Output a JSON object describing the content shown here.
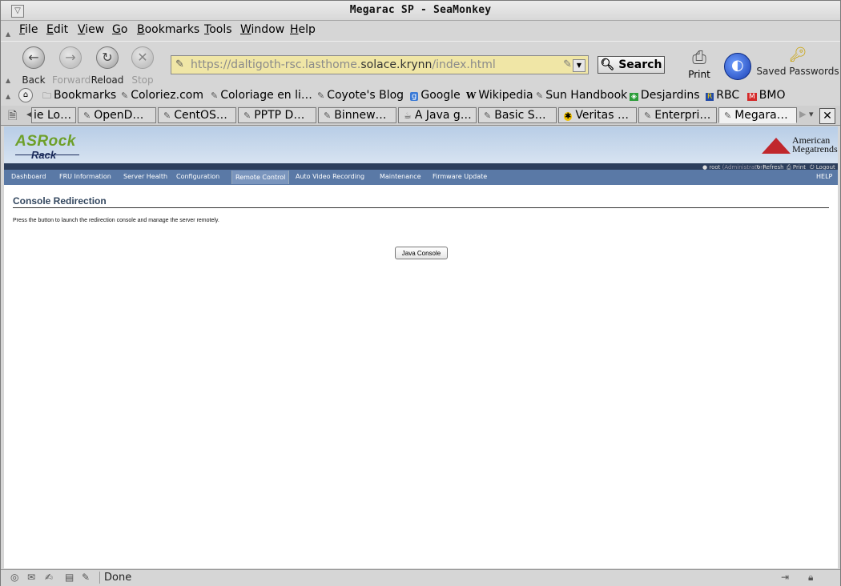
{
  "window": {
    "title": "Megarac SP - SeaMonkey",
    "wm_button": "▽"
  },
  "menubar": {
    "items": [
      {
        "label": "File",
        "underline": "F",
        "rest": "ile"
      },
      {
        "label": "Edit",
        "underline": "E",
        "rest": "dit"
      },
      {
        "label": "View",
        "underline": "V",
        "rest": "iew"
      },
      {
        "label": "Go",
        "underline": "G",
        "rest": "o"
      },
      {
        "label": "Bookmarks",
        "underline": "B",
        "rest": "ookmarks"
      },
      {
        "label": "Tools",
        "underline": "T",
        "rest": "ools"
      },
      {
        "label": "Window",
        "underline": "W",
        "rest": "indow"
      },
      {
        "label": "Help",
        "underline": "H",
        "rest": "elp"
      }
    ]
  },
  "navbar": {
    "back": "Back",
    "forward": "Forward",
    "reload": "Reload",
    "stop": "Stop",
    "url_prefix": "https://daltigoth-rsc.lasthome.",
    "url_host": "solace.krynn",
    "url_suffix": "/index.html",
    "search": "Search",
    "print": "Print",
    "saved_passwords": "Saved Passwords"
  },
  "bookmarks": [
    {
      "label": "Bookmarks",
      "icon": "folder-icon"
    },
    {
      "label": "Coloriez.com",
      "icon": "bookmark-icon"
    },
    {
      "label": "Coloriage en li…",
      "icon": "bookmark-icon"
    },
    {
      "label": "Coyote's Blog",
      "icon": "bookmark-icon"
    },
    {
      "label": "Google",
      "icon": "google-icon"
    },
    {
      "label": "Wikipedia",
      "icon": "wikipedia-icon"
    },
    {
      "label": "Sun Handbook",
      "icon": "bookmark-icon"
    },
    {
      "label": "Desjardins",
      "icon": "desjardins-icon"
    },
    {
      "label": "RBC",
      "icon": "rbc-icon"
    },
    {
      "label": "BMO",
      "icon": "bmo-icon"
    }
  ],
  "tabs": [
    {
      "label": "ie Lo…"
    },
    {
      "label": "OpenD…"
    },
    {
      "label": "CentOS…"
    },
    {
      "label": "PPTP D…"
    },
    {
      "label": "Binnew…"
    },
    {
      "label": "A Java g…"
    },
    {
      "label": "Basic S…"
    },
    {
      "label": "Veritas …"
    },
    {
      "label": "Enterpri…"
    },
    {
      "label": "Megara…"
    }
  ],
  "page": {
    "logo_top": "ASRock",
    "logo_bottom": "Rack",
    "ami_line1": "American",
    "ami_line2": "Megatrends",
    "user": "root",
    "role": "(Administrator)",
    "refresh": "Refresh",
    "print": "Print",
    "logout": "Logout",
    "nav": [
      "Dashboard",
      "FRU Information",
      "Server Health",
      "Configuration",
      "Remote Control",
      "Auto Video Recording",
      "Maintenance",
      "Firmware Update"
    ],
    "help": "HELP",
    "title": "Console Redirection",
    "description": "Press the button to launch the redirection console and manage the server remotely.",
    "button": "Java Console"
  },
  "status": {
    "text": "Done"
  }
}
